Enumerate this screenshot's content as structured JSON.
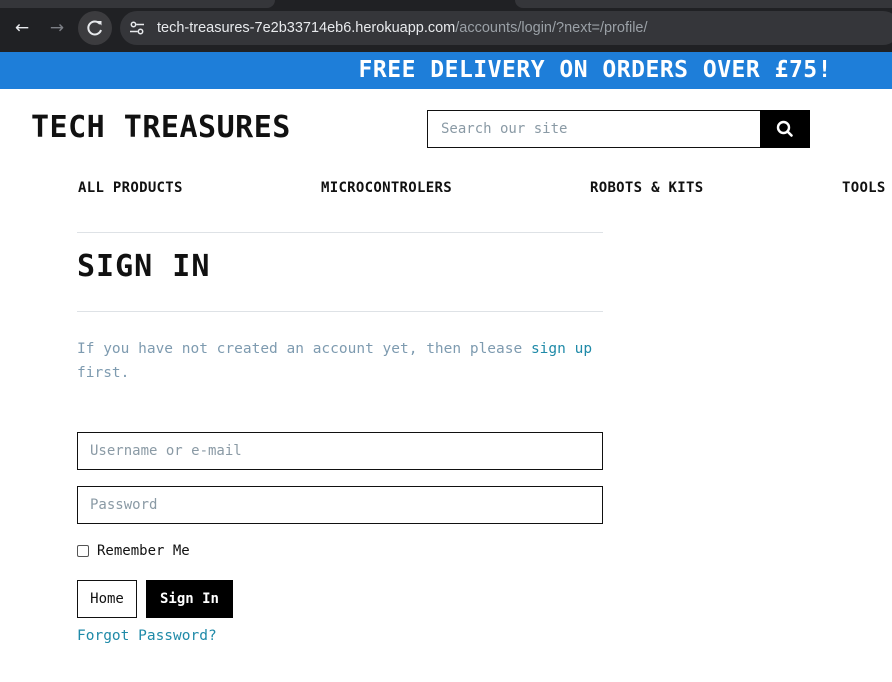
{
  "browser": {
    "url_host": "tech-treasures-7e2b33714eb6.herokuapp.com",
    "url_path": "/accounts/login/?next=/profile/",
    "back_icon": "arrow-left-icon",
    "forward_icon": "arrow-right-icon",
    "reload_icon": "reload-icon",
    "site_info_icon": "tune-icon"
  },
  "promo": {
    "text": "FREE DELIVERY ON ORDERS OVER £75!",
    "color": "#1e7ed9"
  },
  "header": {
    "logo": "TECH TREASURES",
    "search": {
      "placeholder": "Search our site",
      "value": "",
      "icon": "search-icon"
    }
  },
  "nav": {
    "items": [
      {
        "label": "ALL PRODUCTS"
      },
      {
        "label": "MICROCONTROLERS"
      },
      {
        "label": "ROBOTS & KITS"
      },
      {
        "label": "TOOLS"
      }
    ]
  },
  "signin": {
    "title": "SIGN IN",
    "intro_before": "If you have not created an account yet, then please ",
    "intro_link": "sign up",
    "intro_after": " first.",
    "username_placeholder": "Username or e-mail",
    "password_placeholder": "Password",
    "remember_label": "Remember Me",
    "remember_checked": false,
    "home_button": "Home",
    "signin_button": "Sign In",
    "forgot_link": "Forgot Password?"
  },
  "colors": {
    "link": "#1f8aa8",
    "muted_text": "#7e9bb0",
    "dark": "#000000"
  }
}
